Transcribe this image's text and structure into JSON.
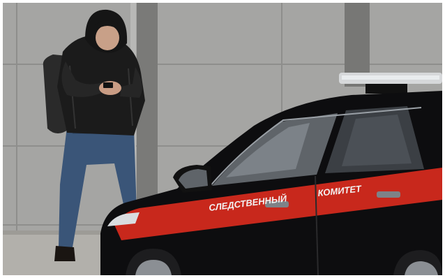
{
  "photo": {
    "subject": "person in a hooded black jacket looking at a phone, walking past a black car with a red stripe in front of a grey concrete wall",
    "colors": {
      "wall": "#a5a5a3",
      "wall_shadow": "#8f8f8d",
      "pillar": "#7a7a78",
      "pavement": "#b2b0ab",
      "car_body": "#0d0d0f",
      "stripe": "#c8281c",
      "jeans": "#3a5578",
      "jacket": "#1b1b1b"
    }
  },
  "car": {
    "front_door_text": "СЛЕДСТВЕННЫЙ",
    "rear_door_text": "КОМИТЕТ"
  }
}
